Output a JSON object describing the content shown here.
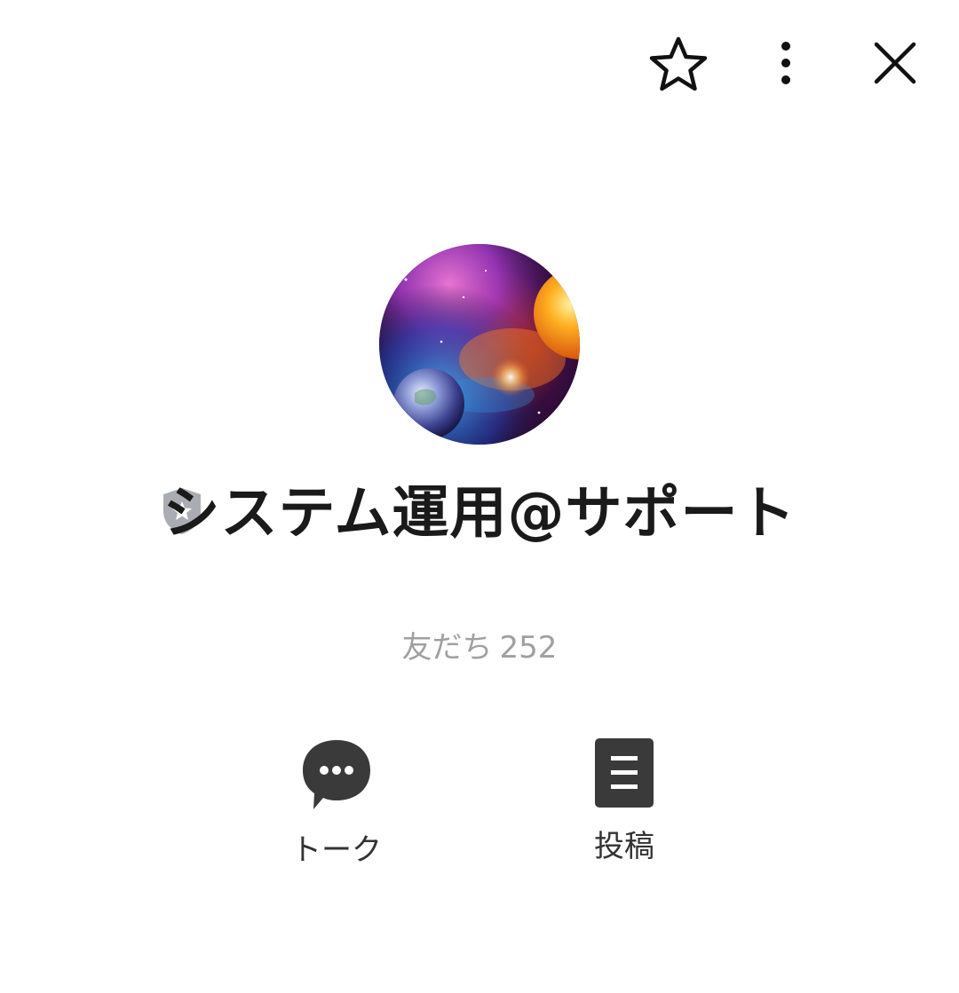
{
  "header": {
    "icons": [
      "star-icon",
      "more-vertical-icon",
      "close-icon"
    ]
  },
  "profile": {
    "name": "システム運用@サポート",
    "badge_icon": "shield-star-icon",
    "friends_label": "友だち",
    "friends_count": "252"
  },
  "actions": [
    {
      "label": "トーク",
      "icon": "chat-bubble-icon"
    },
    {
      "label": "投稿",
      "icon": "post-document-icon"
    }
  ],
  "colors": {
    "background": "#ffffff",
    "name_text": "#1a1a1a",
    "sub_text": "#a0a0a0",
    "icon_dark": "#3a3a3a",
    "badge": "#a9adb3"
  }
}
